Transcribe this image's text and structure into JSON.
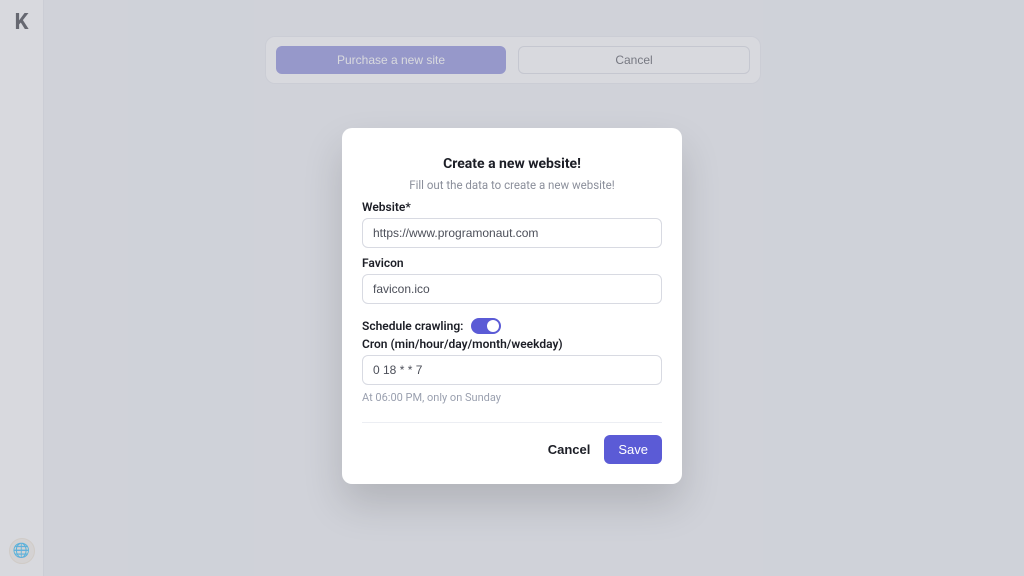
{
  "sidebar": {
    "logo_label": "K"
  },
  "toolbar": {
    "purchase_label": "Purchase a new site",
    "cancel_label": "Cancel"
  },
  "modal": {
    "title": "Create a new website!",
    "subtitle": "Fill out the data to create a new website!",
    "website_label": "Website*",
    "website_value": "https://www.programonaut.com",
    "favicon_label": "Favicon",
    "favicon_value": "favicon.ico",
    "schedule_label": "Schedule crawling:",
    "schedule_on": true,
    "cron_label": "Cron (min/hour/day/month/weekday)",
    "cron_value": "0 18 * * 7",
    "cron_hint": "At 06:00 PM, only on Sunday",
    "cancel_label": "Cancel",
    "save_label": "Save"
  }
}
